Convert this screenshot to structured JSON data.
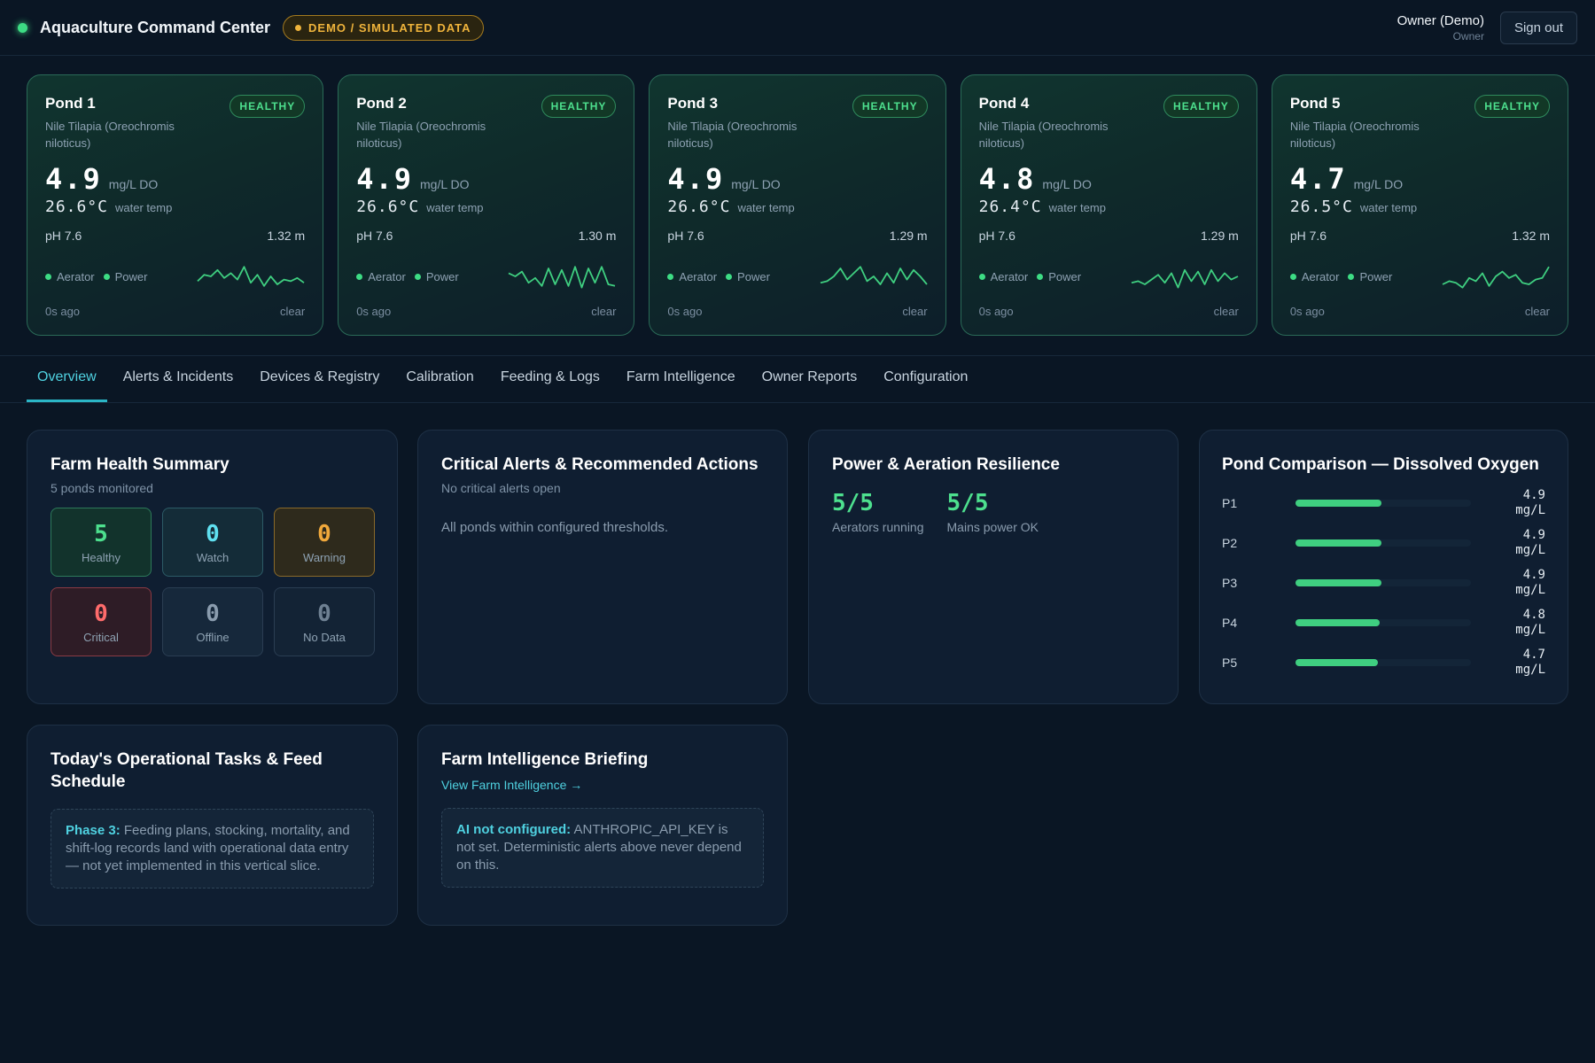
{
  "topbar": {
    "title": "Aquaculture Command Center",
    "demo_badge": "DEMO / SIMULATED DATA",
    "user_name": "Owner (Demo)",
    "user_role": "Owner",
    "signout_label": "Sign out"
  },
  "ponds": [
    {
      "name": "Pond 1",
      "status": "HEALTHY",
      "species": "Nile Tilapia (Oreochromis niloticus)",
      "do": "4.9",
      "do_unit": "mg/L DO",
      "temp": "26.6°C",
      "temp_label": "water temp",
      "ph": "pH 7.6",
      "depth": "1.32 m",
      "aerator": "Aerator",
      "power": "Power",
      "updated": "0s ago",
      "weather": "clear",
      "spark": [
        0.35,
        0.55,
        0.5,
        0.7,
        0.45,
        0.6,
        0.4,
        0.8,
        0.3,
        0.55,
        0.2,
        0.5,
        0.25,
        0.4,
        0.35,
        0.45,
        0.3
      ]
    },
    {
      "name": "Pond 2",
      "status": "HEALTHY",
      "species": "Nile Tilapia (Oreochromis niloticus)",
      "do": "4.9",
      "do_unit": "mg/L DO",
      "temp": "26.6°C",
      "temp_label": "water temp",
      "ph": "pH 7.6",
      "depth": "1.30 m",
      "aerator": "Aerator",
      "power": "Power",
      "updated": "0s ago",
      "weather": "clear",
      "spark": [
        0.6,
        0.5,
        0.65,
        0.3,
        0.45,
        0.2,
        0.75,
        0.25,
        0.7,
        0.2,
        0.8,
        0.15,
        0.75,
        0.3,
        0.8,
        0.25,
        0.2
      ]
    },
    {
      "name": "Pond 3",
      "status": "HEALTHY",
      "species": "Nile Tilapia (Oreochromis niloticus)",
      "do": "4.9",
      "do_unit": "mg/L DO",
      "temp": "26.6°C",
      "temp_label": "water temp",
      "ph": "pH 7.6",
      "depth": "1.29 m",
      "aerator": "Aerator",
      "power": "Power",
      "updated": "0s ago",
      "weather": "clear",
      "spark": [
        0.3,
        0.35,
        0.5,
        0.75,
        0.4,
        0.6,
        0.8,
        0.35,
        0.5,
        0.25,
        0.6,
        0.3,
        0.75,
        0.4,
        0.7,
        0.5,
        0.25
      ]
    },
    {
      "name": "Pond 4",
      "status": "HEALTHY",
      "species": "Nile Tilapia (Oreochromis niloticus)",
      "do": "4.8",
      "do_unit": "mg/L DO",
      "temp": "26.4°C",
      "temp_label": "water temp",
      "ph": "pH 7.6",
      "depth": "1.29 m",
      "aerator": "Aerator",
      "power": "Power",
      "updated": "0s ago",
      "weather": "clear",
      "spark": [
        0.3,
        0.35,
        0.25,
        0.4,
        0.55,
        0.3,
        0.6,
        0.15,
        0.7,
        0.35,
        0.65,
        0.25,
        0.7,
        0.35,
        0.6,
        0.4,
        0.5
      ]
    },
    {
      "name": "Pond 5",
      "status": "HEALTHY",
      "species": "Nile Tilapia (Oreochromis niloticus)",
      "do": "4.7",
      "do_unit": "mg/L DO",
      "temp": "26.5°C",
      "temp_label": "water temp",
      "ph": "pH 7.6",
      "depth": "1.32 m",
      "aerator": "Aerator",
      "power": "Power",
      "updated": "0s ago",
      "weather": "clear",
      "spark": [
        0.25,
        0.35,
        0.3,
        0.15,
        0.45,
        0.35,
        0.6,
        0.2,
        0.5,
        0.65,
        0.45,
        0.55,
        0.3,
        0.25,
        0.4,
        0.45,
        0.8
      ]
    }
  ],
  "tabs": [
    {
      "label": "Overview",
      "active": true
    },
    {
      "label": "Alerts & Incidents",
      "active": false
    },
    {
      "label": "Devices & Registry",
      "active": false
    },
    {
      "label": "Calibration",
      "active": false
    },
    {
      "label": "Feeding & Logs",
      "active": false
    },
    {
      "label": "Farm Intelligence",
      "active": false
    },
    {
      "label": "Owner Reports",
      "active": false
    },
    {
      "label": "Configuration",
      "active": false
    }
  ],
  "health": {
    "title": "Farm Health Summary",
    "subtitle": "5 ponds monitored",
    "cells": [
      {
        "value": "5",
        "label": "Healthy",
        "kind": "healthy"
      },
      {
        "value": "0",
        "label": "Watch",
        "kind": "watch"
      },
      {
        "value": "0",
        "label": "Warning",
        "kind": "warning"
      },
      {
        "value": "0",
        "label": "Critical",
        "kind": "critical"
      },
      {
        "value": "0",
        "label": "Offline",
        "kind": "offline"
      },
      {
        "value": "0",
        "label": "No Data",
        "kind": "nodata"
      }
    ]
  },
  "alerts": {
    "title": "Critical Alerts & Recommended Actions",
    "subtitle": "No critical alerts open",
    "body": "All ponds within configured thresholds."
  },
  "resilience": {
    "title": "Power & Aeration Resilience",
    "aerators_value": "5/5",
    "aerators_label": "Aerators running",
    "mains_value": "5/5",
    "mains_label": "Mains power OK"
  },
  "comparison": {
    "title": "Pond Comparison — Dissolved Oxygen",
    "unit": "mg/L",
    "rows": [
      {
        "label": "P1",
        "value": "4.9",
        "fill": 0.49
      },
      {
        "label": "P2",
        "value": "4.9",
        "fill": 0.49
      },
      {
        "label": "P3",
        "value": "4.9",
        "fill": 0.49
      },
      {
        "label": "P4",
        "value": "4.8",
        "fill": 0.48
      },
      {
        "label": "P5",
        "value": "4.7",
        "fill": 0.47
      }
    ]
  },
  "tasks": {
    "title": "Today's Operational Tasks & Feed Schedule",
    "callout_lead": "Phase 3:",
    "callout_text": " Feeding plans, stocking, mortality, and shift-log records land with operational data entry — not yet implemented in this vertical slice."
  },
  "briefing": {
    "title": "Farm Intelligence Briefing",
    "link": "View Farm Intelligence →",
    "callout_lead": "AI not configured:",
    "callout_text": " ANTHROPIC_API_KEY is not set. Deterministic alerts above never depend on this."
  },
  "colors": {
    "accent": "#4fd1e0",
    "healthy": "#4de08e",
    "warning": "#f0a83b",
    "critical": "#ff6b6b",
    "background": "#0a1624"
  }
}
